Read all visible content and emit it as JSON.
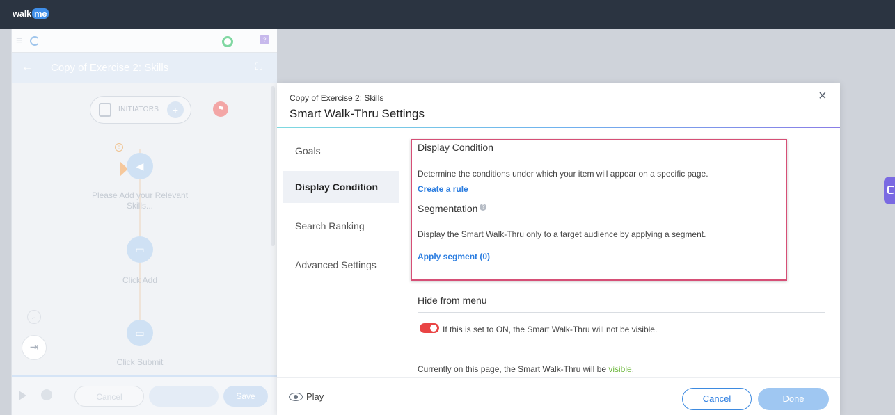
{
  "app": {
    "logo_text": "walk",
    "logo_badge": "me"
  },
  "editor": {
    "title": "Copy of Exercise 2: Skills",
    "initiators_label": "INITIATORS",
    "steps": [
      {
        "label": "Please Add your Relevant Skills..."
      },
      {
        "label": "Click Add"
      },
      {
        "label": "Click Submit"
      }
    ],
    "footer": {
      "cancel_label": "Cancel",
      "save_label": "Save"
    }
  },
  "modal": {
    "subtitle": "Copy of Exercise 2: Skills",
    "title": "Smart Walk-Thru Settings",
    "close_label": "×",
    "nav": [
      {
        "label": "Goals",
        "active": false
      },
      {
        "label": "Display Condition",
        "active": true
      },
      {
        "label": "Search Ranking",
        "active": false
      },
      {
        "label": "Advanced Settings",
        "active": false
      }
    ],
    "display_condition": {
      "title": "Display Condition",
      "description": "Determine the conditions under which your item will appear on a specific page.",
      "link": "Create a rule"
    },
    "segmentation": {
      "title": "Segmentation",
      "description": "Display the Smart Walk-Thru only to a target audience by applying a segment.",
      "link": "Apply segment (0)"
    },
    "hide_from_menu": {
      "title": "Hide from menu",
      "toggle_on": true,
      "toggle_text": "If this is set to ON, the Smart Walk-Thru will not be visible.",
      "status_prefix": "Currently on this page, the Smart Walk-Thru will be ",
      "status_word": "visible",
      "status_suffix": "."
    },
    "footer": {
      "play_label": "Play",
      "cancel_label": "Cancel",
      "done_label": "Done"
    }
  },
  "colors": {
    "highlight": "#d64f76",
    "toggle_on": "#e94444",
    "link": "#2b7de0",
    "visible": "#6fb83f",
    "done": "#9fc7f2"
  }
}
